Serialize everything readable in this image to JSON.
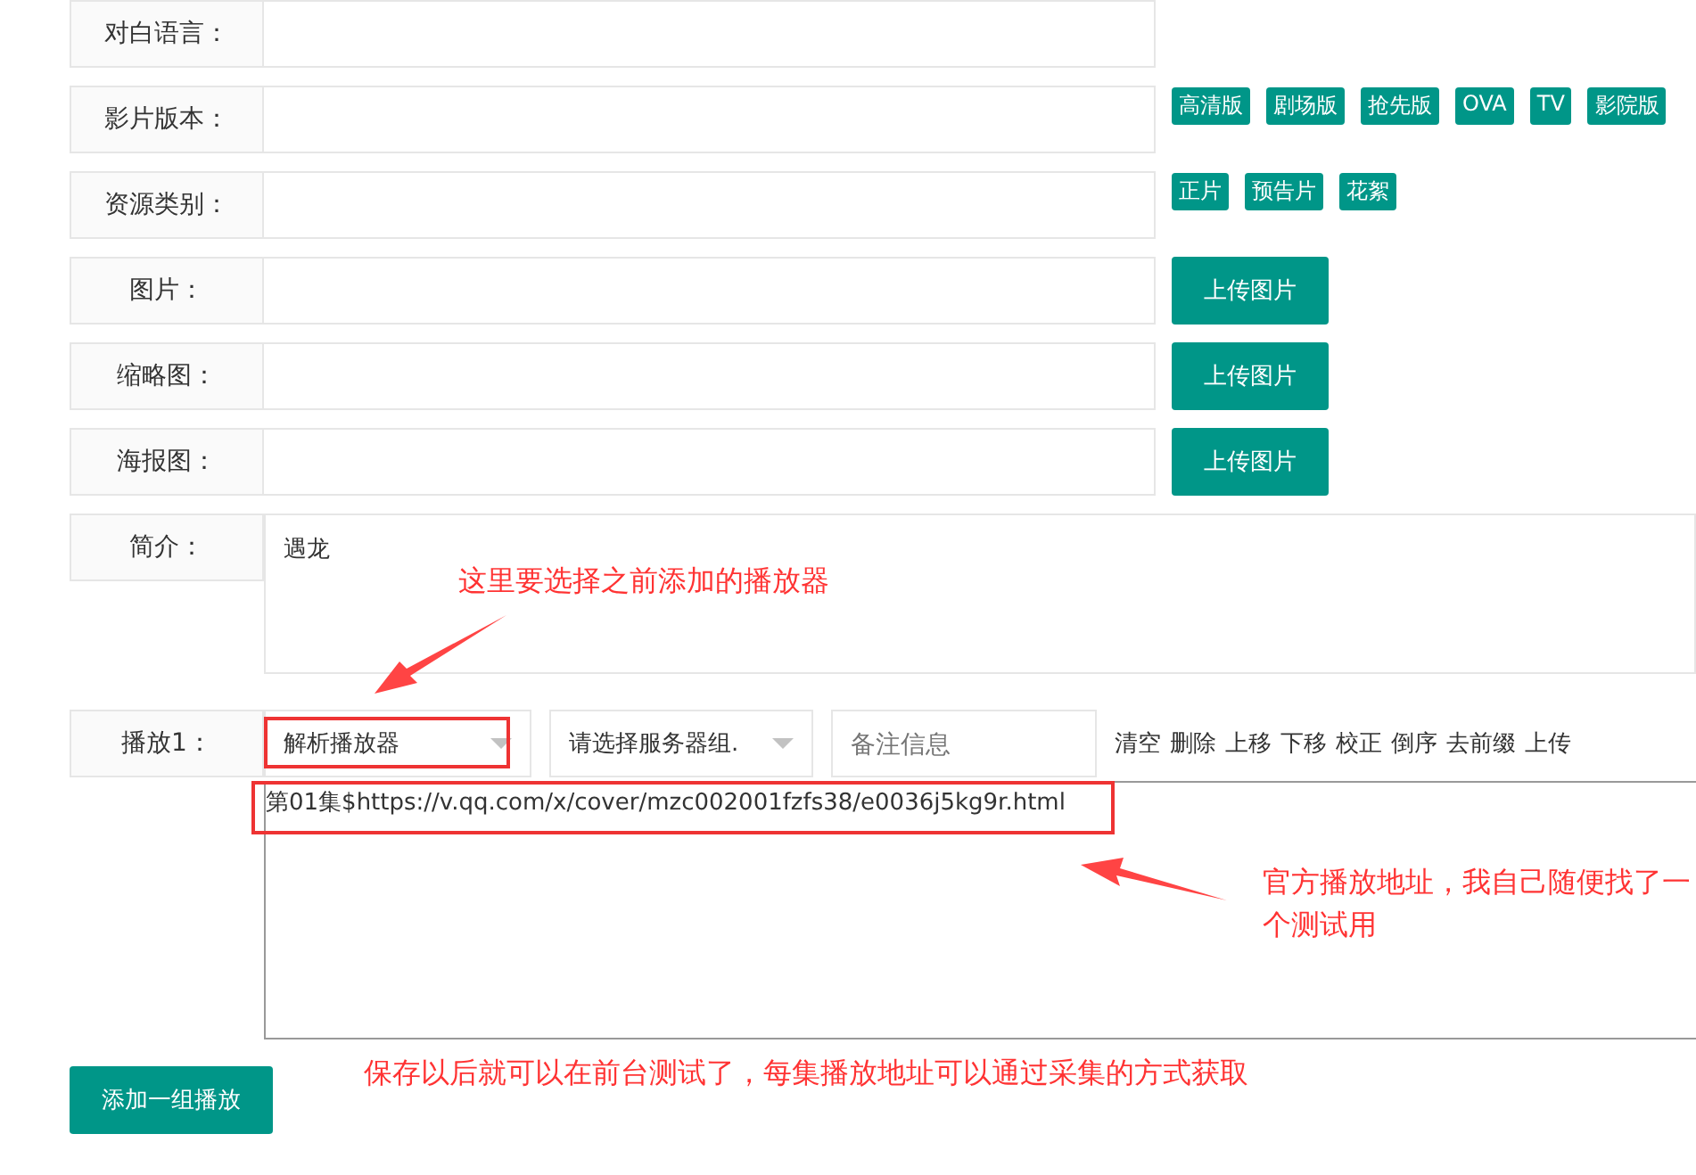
{
  "fields": [
    {
      "label": "对白语言：",
      "kind": "plain"
    },
    {
      "label": "影片版本：",
      "kind": "tags",
      "tags": [
        "高清版",
        "剧场版",
        "抢先版",
        "OVA",
        "TV",
        "影院版"
      ]
    },
    {
      "label": "资源类别：",
      "kind": "tags",
      "tags": [
        "正片",
        "预告片",
        "花絮"
      ]
    },
    {
      "label": "图片：",
      "kind": "upload",
      "button": "上传图片"
    },
    {
      "label": "缩略图：",
      "kind": "upload",
      "button": "上传图片"
    },
    {
      "label": "海报图：",
      "kind": "upload",
      "button": "上传图片"
    },
    {
      "label": "简介：",
      "kind": "textarea",
      "value": "遇龙"
    }
  ],
  "play": {
    "label": "播放1：",
    "player": "解析播放器",
    "server": "请选择服务器组.",
    "note_placeholder": "备注信息",
    "actions": [
      "清空",
      "删除",
      "上移",
      "下移",
      "校正",
      "倒序",
      "去前缀",
      "上传"
    ],
    "urls": "第01集$https://v.qq.com/x/cover/mzc002001fzfs38/e0036j5kg9r.html"
  },
  "add_button": "添加一组播放",
  "annotations": [
    "这里要选择之前添加的播放器",
    "官方播放地址，我自己随便找了一个测试用",
    "保存以后就可以在前台测试了，每集播放地址可以通过采集的方式获取"
  ]
}
